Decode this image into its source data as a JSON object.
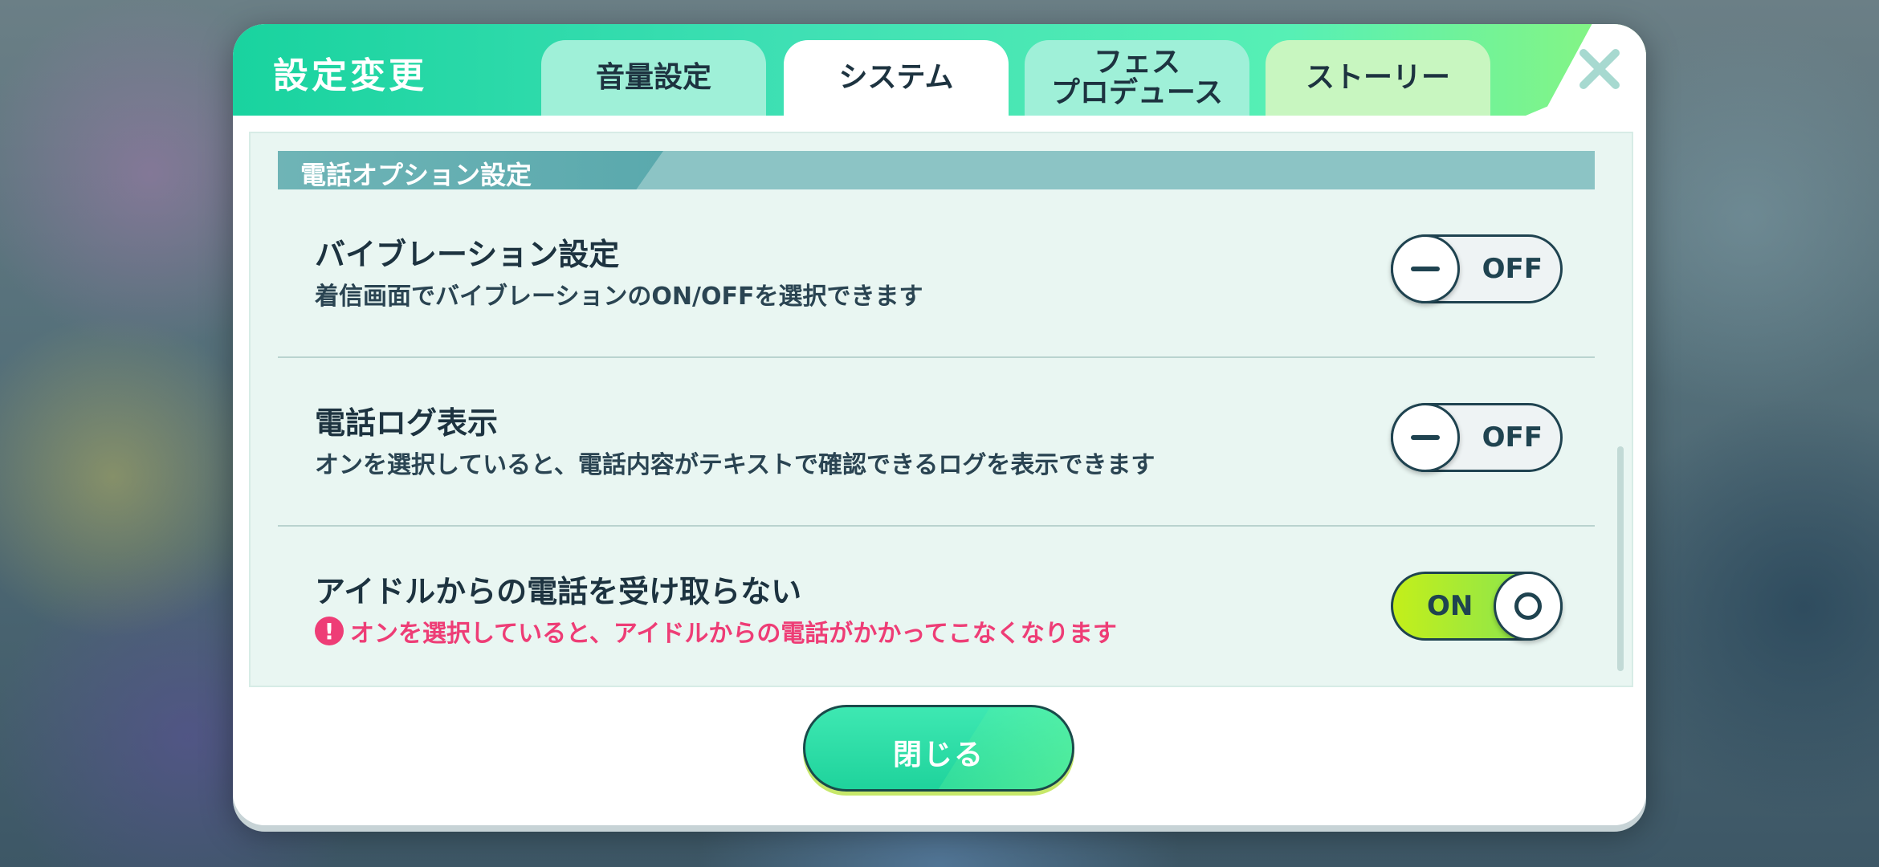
{
  "dialog": {
    "title": "設定変更",
    "tabs": [
      {
        "label": "音量設定",
        "active": false
      },
      {
        "label": "システム",
        "active": true
      },
      {
        "label": "フェス\nプロデュース",
        "active": false
      },
      {
        "label": "ストーリー",
        "active": false
      }
    ],
    "close_icon": "close-x-icon"
  },
  "section": {
    "title": "電話オプション設定"
  },
  "settings": [
    {
      "title": "バイブレーション設定",
      "description": "着信画面でバイブレーションのON/OFFを選択できます",
      "toggle": "OFF"
    },
    {
      "title": "電話ログ表示",
      "description": "オンを選択していると、電話内容がテキストで確認できるログを表示できます",
      "toggle": "OFF"
    },
    {
      "title": "アイドルからの電話を受け取らない",
      "warning": "オンを選択していると、アイドルからの電話がかかってこなくなります",
      "warning_icon": "!",
      "toggle": "ON"
    }
  ],
  "footer": {
    "close_label": "閉じる"
  },
  "colors": {
    "accent": "#1fd39c",
    "warning": "#ee3d76",
    "text": "#1d3340"
  }
}
